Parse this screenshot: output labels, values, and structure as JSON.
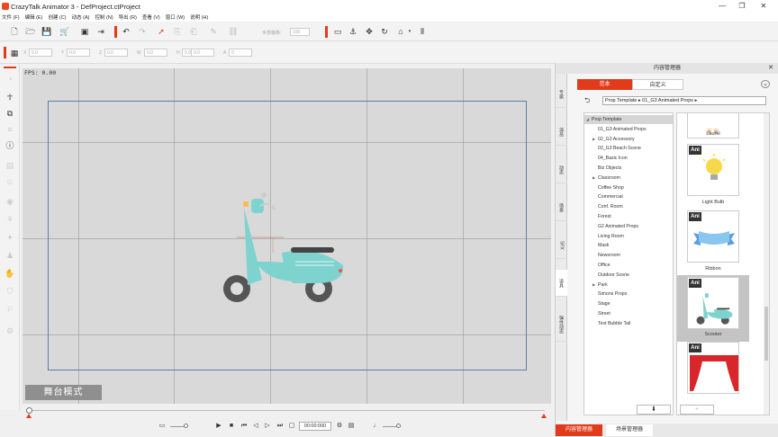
{
  "window": {
    "title": "CrazyTalk Animator 3 - DefProject.ctProject",
    "minimize": "—",
    "maximize": "❐",
    "close": "✕"
  },
  "menu": [
    "文件 (F)",
    "编辑 (E)",
    "创建 (C)",
    "动态 (A)",
    "控制 (N)",
    "导出 (R)",
    "查看 (V)",
    "窗口 (W)",
    "说明 (H)"
  ],
  "toolbar1": {
    "label_speed": "手部偏移:",
    "speed_value": "100"
  },
  "toolbar2": {
    "x_label": "X",
    "y_label": "Y",
    "z_label": "Z",
    "w_label": "W",
    "h_label": "H",
    "a_label": "A",
    "fields": [
      "0.0",
      "0.0",
      "0.0",
      "0.0",
      "0.0",
      "0.0",
      "0"
    ]
  },
  "stage": {
    "fps": "FPS: 0.00",
    "mode_button": "舞台模式"
  },
  "timeline": {
    "timecode": "00:00:000"
  },
  "panel": {
    "title": "内容管理器",
    "close": "✕",
    "tabs": [
      "范本",
      "自定义"
    ],
    "side_tabs": [
      "专案",
      "演员",
      "动态",
      "场景",
      "SFX",
      "道具",
      "弹性动态"
    ],
    "path": "Prop Template ▸ 01_G3 Animated Props ▸",
    "tree_root": "Prop Template",
    "tree_items": [
      "01_G3 Animated Props",
      "02_G3 Accessory",
      "03_G3 Beach Scene",
      "04_Basic Icon",
      "Biz Objects",
      "Classroom",
      "Coffee Shop",
      "Commercial",
      "Conf. Room",
      "Forest",
      "G2 Animated Props",
      "Living Room",
      "Mask",
      "Newsroom",
      "Office",
      "Outdoor Scene",
      "Park",
      "Simons Props",
      "Stage",
      "Street",
      "Text Bubble Tail"
    ],
    "thumbs": [
      {
        "label": "Laurel",
        "badge": ""
      },
      {
        "label": "Light Bulb",
        "badge": "Ani"
      },
      {
        "label": "Ribbon",
        "badge": "Ani"
      },
      {
        "label": "Scooter",
        "badge": "Ani"
      },
      {
        "label": "",
        "badge": "Ani"
      }
    ],
    "download_button": "⬇",
    "add_button": "+",
    "bottom_tabs": [
      "内容管理器",
      "场景管理器"
    ]
  },
  "colors": {
    "accent": "#e23b1a",
    "scooter_body": "#7fd3cf",
    "wheel": "#555555"
  }
}
